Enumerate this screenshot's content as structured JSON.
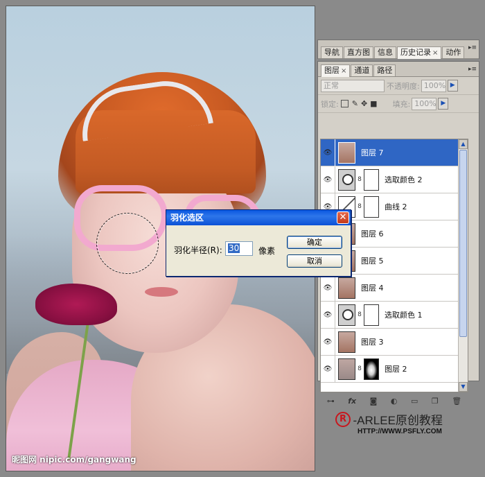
{
  "canvas": {
    "watermark": "昵图网 nipic.com/gangwang"
  },
  "top_panel": {
    "tabs": [
      "导航",
      "直方图",
      "信息",
      "历史记录",
      "动作"
    ],
    "active_tab": "历史记录",
    "close_glyph": "×",
    "menu_glyph": "▸≡"
  },
  "layers_panel": {
    "tabs": [
      "图层",
      "通道",
      "路径"
    ],
    "active_tab": "图层",
    "close_glyph": "×",
    "blend_mode": "正常",
    "opacity_label": "不透明度:",
    "opacity_value": "100%",
    "lock_label": "锁定:",
    "fill_label": "填充:",
    "fill_value": "100%",
    "layers": [
      {
        "name": "图层 7",
        "kind": "pixel",
        "selected": true
      },
      {
        "name": "选取颜色 2",
        "kind": "adjustment"
      },
      {
        "name": "曲线 2",
        "kind": "curves"
      },
      {
        "name": "图层 6",
        "kind": "pixel"
      },
      {
        "name": "图层 5",
        "kind": "pixel"
      },
      {
        "name": "图层 4",
        "kind": "pixel"
      },
      {
        "name": "选取颜色 1",
        "kind": "adjustment"
      },
      {
        "name": "图层 3",
        "kind": "pixel"
      },
      {
        "name": "图层 2",
        "kind": "masked"
      }
    ],
    "footer_icons": [
      "link-icon",
      "fx-icon",
      "mask-icon",
      "adjustment-icon",
      "folder-icon",
      "new-layer-icon",
      "trash-icon"
    ]
  },
  "dialog": {
    "title": "羽化选区",
    "field_label": "羽化半径(R):",
    "field_value": "30",
    "unit": "像素",
    "ok_label": "确定",
    "cancel_label": "取消",
    "close_glyph": "✕"
  },
  "logo": {
    "mark": "R",
    "text": "-ARLEE原创教程",
    "url": "HTTP://WWW.PSFLY.COM"
  },
  "colors": {
    "selection_blue": "#2f66c4",
    "xp_title_blue": "#0a57e0",
    "logo_red": "#c8161d"
  }
}
